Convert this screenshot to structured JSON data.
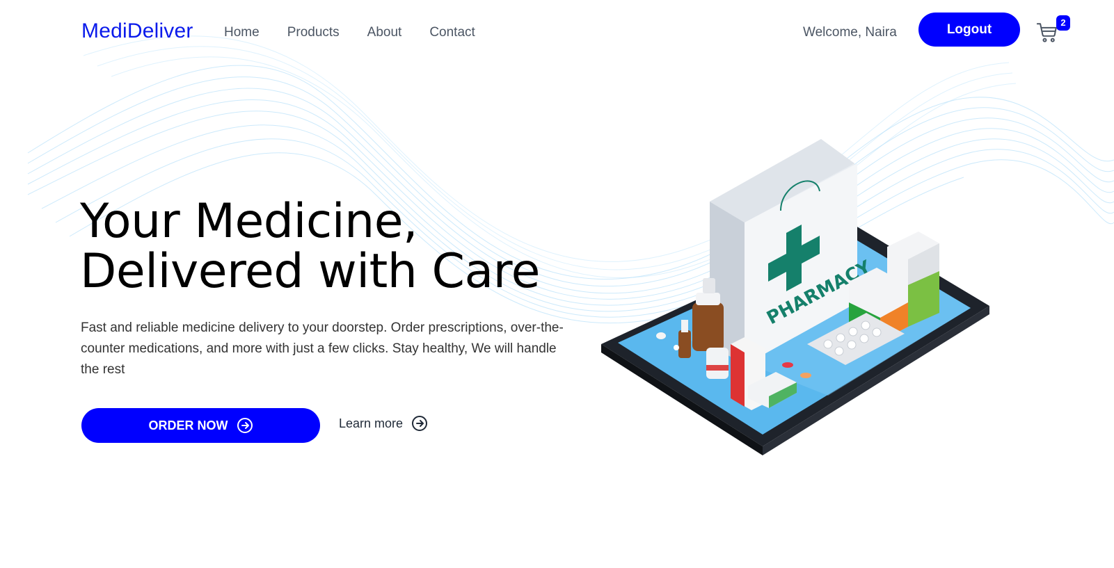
{
  "nav": {
    "logo": "MediDeliver",
    "links": [
      "Home",
      "Products",
      "About",
      "Contact"
    ],
    "welcome": "Welcome, Naira",
    "logout_label": "Logout",
    "cart_count": "2"
  },
  "hero": {
    "title_line1": "Your Medicine,",
    "title_line2": "Delivered with Care",
    "description": "Fast and reliable medicine delivery to your doorstep. Order prescriptions, over-the-counter medications, and more with just a few clicks. Stay healthy, We will handle the rest",
    "order_button_label": "ORDER NOW",
    "learn_more_label": "Learn more"
  },
  "illustration": {
    "bag_label": "PHARMACY"
  },
  "colors": {
    "brand": "#0a1aeb",
    "button": "#0000ff",
    "cross": "#15806b",
    "tablet_screen": "#5ab8ee"
  },
  "icons": {
    "cart": "shopping-cart-icon",
    "arrow": "arrow-right-circle-icon"
  }
}
